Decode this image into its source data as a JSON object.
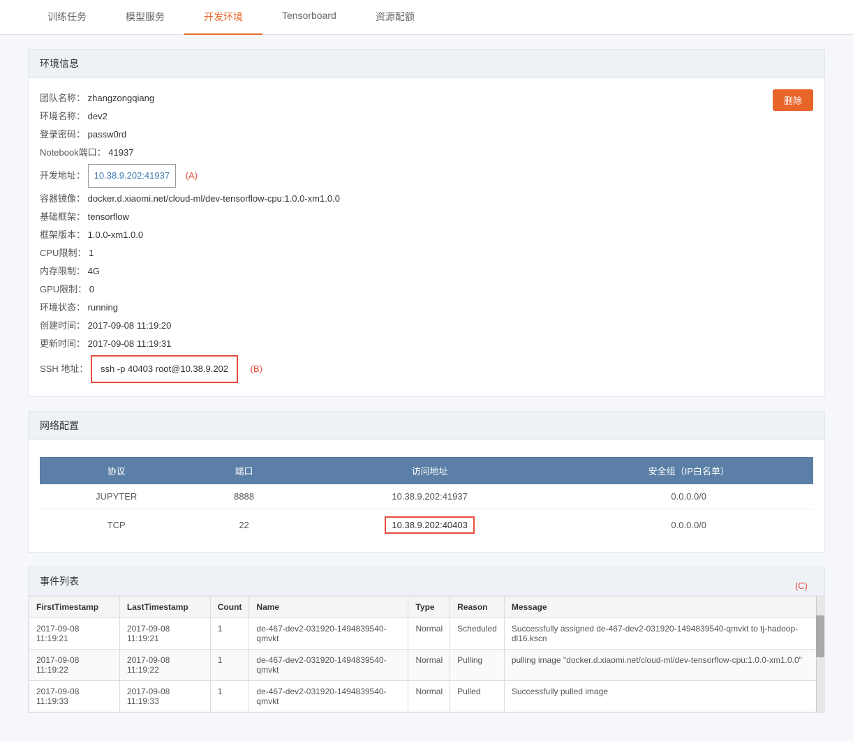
{
  "tabs": [
    {
      "id": "train",
      "label": "训练任务",
      "active": false
    },
    {
      "id": "model",
      "label": "模型服务",
      "active": false
    },
    {
      "id": "dev",
      "label": "开发环境",
      "active": true
    },
    {
      "id": "tensorboard",
      "label": "Tensorboard",
      "active": false
    },
    {
      "id": "resource",
      "label": "资源配额",
      "active": false
    }
  ],
  "env_section": {
    "title": "环境信息",
    "delete_label": "删除",
    "fields": [
      {
        "label": "团队名称：",
        "value": "zhangzongqiang"
      },
      {
        "label": "环境名称：",
        "value": "dev2"
      },
      {
        "label": "登录密码：",
        "value": "passw0rd"
      },
      {
        "label": "Notebook端口：",
        "value": "41937"
      },
      {
        "label": "开发地址：",
        "value": "10.38.9.202:41937",
        "type": "link",
        "tag": "(A)"
      },
      {
        "label": "容器镜像：",
        "value": "docker.d.xiaomi.net/cloud-ml/dev-tensorflow-cpu:1.0.0-xm1.0.0"
      },
      {
        "label": "基础框架：",
        "value": "tensorflow"
      },
      {
        "label": "框架版本：",
        "value": "1.0.0-xm1.0.0"
      },
      {
        "label": "CPU限制：",
        "value": "1"
      },
      {
        "label": "内存限制：",
        "value": "4G"
      },
      {
        "label": "GPU限制：",
        "value": "0"
      },
      {
        "label": "环境状态：",
        "value": "running"
      },
      {
        "label": "创建时间：",
        "value": "2017-09-08 11:19:20"
      },
      {
        "label": "更新时间：",
        "value": "2017-09-08 11:19:31"
      },
      {
        "label": "SSH 地址：",
        "value": "ssh -p 40403 root@10.38.9.202",
        "type": "ssh",
        "tag": "(B)"
      }
    ]
  },
  "network_section": {
    "title": "网络配置",
    "table_headers": [
      "协议",
      "端口",
      "访问地址",
      "安全组（IP白名单）"
    ],
    "rows": [
      {
        "protocol": "JUPYTER",
        "port": "8888",
        "address": "10.38.9.202:41937",
        "security": "0.0.0.0/0",
        "highlight": false
      },
      {
        "protocol": "TCP",
        "port": "22",
        "address": "10.38.9.202:40403",
        "security": "0.0.0.0/0",
        "highlight": true
      }
    ]
  },
  "events_section": {
    "title": "事件列表",
    "c_label": "(C)",
    "table_headers": [
      "FirstTimestamp",
      "LastTimestamp",
      "Count",
      "Name",
      "Type",
      "Reason",
      "Message"
    ],
    "rows": [
      {
        "first_ts": "2017-09-08 11:19:21",
        "last_ts": "2017-09-08 11:19:21",
        "count": "1",
        "name": "de-467-dev2-031920-1494839540-qmvkt",
        "type": "Normal",
        "reason": "Scheduled",
        "message": "Successfully assigned de-467-dev2-031920-1494839540-qmvkt to tj-hadoop-dl16.kscn"
      },
      {
        "first_ts": "2017-09-08 11:19:22",
        "last_ts": "2017-09-08 11:19:22",
        "count": "1",
        "name": "de-467-dev2-031920-1494839540-qmvkt",
        "type": "Normal",
        "reason": "Pulling",
        "message": "pulling image \"docker.d.xiaomi.net/cloud-ml/dev-tensorflow-cpu:1.0.0-xm1.0.0\""
      },
      {
        "first_ts": "2017-09-08 11:19:33",
        "last_ts": "2017-09-08 11:19:33",
        "count": "1",
        "name": "de-467-dev2-031920-1494839540-qmvkt",
        "type": "Normal",
        "reason": "Pulled",
        "message": "Successfully pulled image"
      }
    ]
  }
}
